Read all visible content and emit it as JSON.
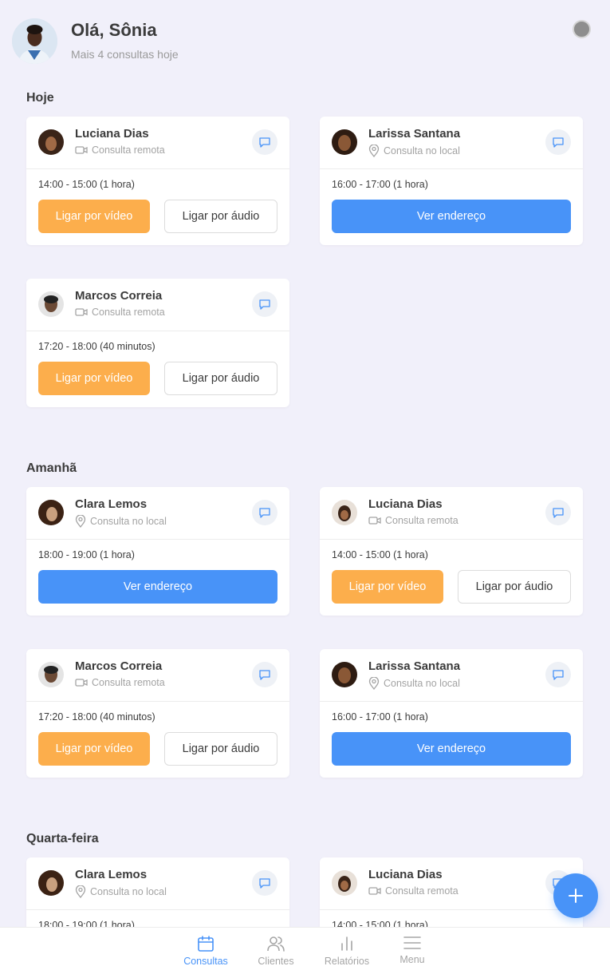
{
  "header": {
    "greeting": "Olá, Sônia",
    "subtitle": "Mais 4 consultas hoje"
  },
  "sections": [
    {
      "title": "Hoje",
      "cards": [
        {
          "name": "Luciana Dias",
          "type": "Consulta remota",
          "time": "14:00 - 15:00 (1 hora)",
          "video_label": "Ligar por vídeo",
          "audio_label": "Ligar por áudio"
        },
        {
          "name": "Larissa Santana",
          "type": "Consulta no local",
          "time": "16:00 - 17:00 (1 hora)",
          "address_label": "Ver endereço"
        },
        {
          "name": "Marcos Correia",
          "type": "Consulta remota",
          "time": "17:20 - 18:00 (40 minutos)",
          "video_label": "Ligar por vídeo",
          "audio_label": "Ligar por áudio"
        }
      ]
    },
    {
      "title": "Amanhã",
      "cards": [
        {
          "name": "Clara Lemos",
          "type": "Consulta no local",
          "time": "18:00 - 19:00 (1 hora)",
          "address_label": "Ver endereço"
        },
        {
          "name": "Luciana Dias",
          "type": "Consulta remota",
          "time": "14:00 - 15:00 (1 hora)",
          "video_label": "Ligar por vídeo",
          "audio_label": "Ligar por áudio"
        },
        {
          "name": "Marcos Correia",
          "type": "Consulta remota",
          "time": "17:20 - 18:00 (40 minutos)",
          "video_label": "Ligar por vídeo",
          "audio_label": "Ligar por áudio"
        },
        {
          "name": "Larissa Santana",
          "type": "Consulta no local",
          "time": "16:00 - 17:00 (1 hora)",
          "address_label": "Ver endereço"
        }
      ]
    },
    {
      "title": "Quarta-feira",
      "cards": [
        {
          "name": "Clara Lemos",
          "type": "Consulta no local",
          "time": "18:00 - 19:00 (1 hora)"
        },
        {
          "name": "Luciana Dias",
          "type": "Consulta remota",
          "time": "14:00 - 15:00 (1 hora)"
        }
      ]
    }
  ],
  "nav": [
    {
      "label": "Consultas",
      "icon": "calendar-icon",
      "active": true
    },
    {
      "label": "Clientes",
      "icon": "users-icon"
    },
    {
      "label": "Relatórios",
      "icon": "bar-chart-icon"
    },
    {
      "label": "Menu",
      "icon": "menu-icon"
    }
  ],
  "colors": {
    "primary": "#4893f8",
    "video": "#fcae4c",
    "background": "#f1f0fa"
  }
}
